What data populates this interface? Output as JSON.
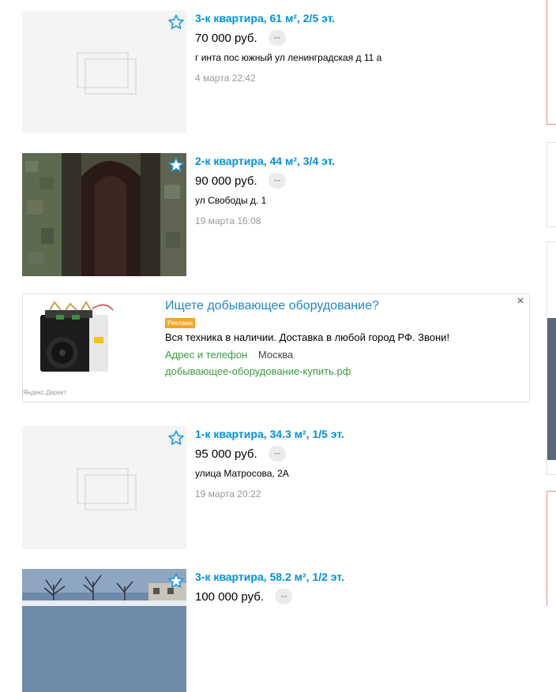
{
  "listings": [
    {
      "title": "3-к квартира, 61 м², 2/5 эт.",
      "price": "70 000 руб.",
      "address": "г инта пос южный ул ленинградская д 11 а",
      "date": "4 марта 22:42",
      "more": "···"
    },
    {
      "title": "2-к квартира, 44 м², 3/4 эт.",
      "price": "90 000 руб.",
      "address": "ул Свободы д. 1",
      "date": "19 марта 16:08",
      "more": "···"
    },
    {
      "title": "1-к квартира, 34.3 м², 1/5 эт.",
      "price": "95 000 руб.",
      "address": "улица Матросова, 2А",
      "date": "19 марта 20:22",
      "more": "···"
    },
    {
      "title": "3-к квартира, 58.2 м², 1/2 эт.",
      "price": "100 000 руб.",
      "address": "",
      "date": "",
      "more": "···"
    }
  ],
  "ad": {
    "title": "Ищете добывающее оборудование?",
    "badge": "Реклама",
    "text": "Вся техника в наличии. Доставка в любой город РФ. Звони!",
    "contacts": "Адрес и телефон",
    "city": "Москва",
    "domain": "добывающее-оборудование-купить.рф",
    "source": "Яндекс.Директ",
    "close": "×"
  },
  "colors": {
    "link": "#0091d9",
    "ad_link": "#1e87c8",
    "ad_green": "#3a9c3f",
    "badge": "#f5a623"
  }
}
